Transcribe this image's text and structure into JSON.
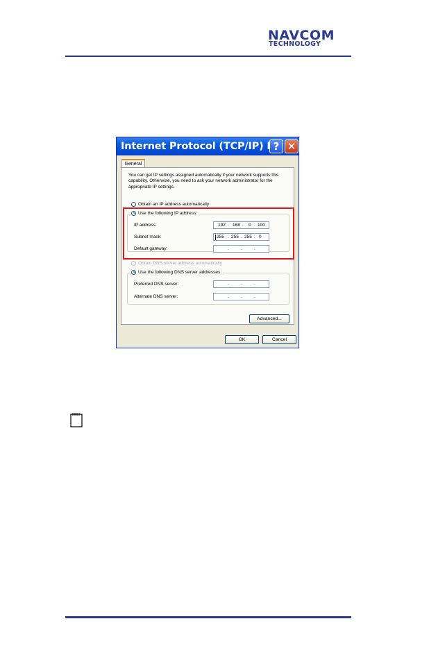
{
  "header": {
    "logo_line1": "NAVCOM",
    "logo_line2": "TECHNOLOGY",
    "brand_color": "#2b3a8c"
  },
  "dialog": {
    "title": "Internet Protocol (TCP/IP) P...",
    "help_glyph": "?",
    "close_glyph": "✕",
    "tab_general": "General",
    "intro_text": "You can get IP settings assigned automatically if your network supports this capability. Otherwise, you need to ask your network administrator for the appropriate IP settings.",
    "radio_auto_ip": "Obtain an IP address automatically",
    "radio_static_ip": "Use the following IP address:",
    "ip_address_label": "IP address:",
    "ip_address": [
      "192",
      "168",
      "0",
      "100"
    ],
    "subnet_mask_label": "Subnet mask:",
    "subnet_mask": [
      "255",
      "255",
      "255",
      "0"
    ],
    "default_gateway_label": "Default gateway:",
    "default_gateway": [
      "",
      "",
      "",
      ""
    ],
    "radio_auto_dns": "Obtain DNS server address automatically",
    "radio_static_dns": "Use the following DNS server addresses:",
    "preferred_dns_label": "Preferred DNS server:",
    "alternate_dns_label": "Alternate DNS server:",
    "advanced_button": "Advanced...",
    "ok_button": "OK",
    "cancel_button": "Cancel",
    "highlight_color": "#e1151a"
  },
  "note_icon": "notepad-icon"
}
